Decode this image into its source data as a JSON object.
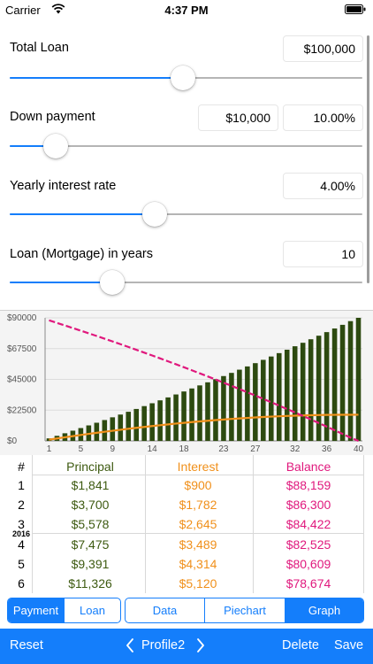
{
  "status": {
    "carrier": "Carrier",
    "time": "4:37 PM"
  },
  "fields": {
    "total_loan": {
      "label": "Total Loan",
      "value": "$100,000",
      "slider_fraction": 0.49
    },
    "down_payment": {
      "label": "Down payment",
      "value": "$10,000",
      "percent": "10.00%",
      "slider_fraction": 0.13
    },
    "interest_rate": {
      "label": "Yearly interest rate",
      "value": "4.00%",
      "slider_fraction": 0.41
    },
    "years": {
      "label": "Loan (Mortgage) in years",
      "value": "10",
      "slider_fraction": 0.29
    }
  },
  "chart_data": {
    "type": "bar",
    "x_ticks": [
      "1",
      "5",
      "9",
      "14",
      "18",
      "23",
      "27",
      "32",
      "36",
      "40"
    ],
    "y_ticks": [
      "$0",
      "$22500",
      "$45000",
      "$67500",
      "$90000"
    ],
    "ylim": [
      0,
      90000
    ],
    "x_count": 40,
    "series": [
      {
        "type": "bar",
        "color": "#2d4a10",
        "values": [
          1841,
          3700,
          5578,
          7475,
          9391,
          11326,
          13280,
          15255,
          17250,
          19265,
          21301,
          23358,
          25436,
          27535,
          29655,
          31797,
          33961,
          36147,
          38355,
          40586,
          42840,
          45117,
          47417,
          49741,
          52089,
          54460,
          56856,
          59277,
          61722,
          64193,
          66689,
          69210,
          71757,
          74330,
          76929,
          79555,
          82208,
          84887,
          87594,
          90000
        ]
      },
      {
        "type": "line",
        "color": "#f0901b",
        "values": [
          900,
          1782,
          2645,
          3489,
          4314,
          5120,
          5907,
          6674,
          7421,
          8148,
          8855,
          9541,
          10206,
          10850,
          11472,
          12072,
          12650,
          13206,
          13739,
          14249,
          14736,
          15199,
          15638,
          16053,
          16443,
          16808,
          17148,
          17462,
          17750,
          18012,
          18247,
          18455,
          18635,
          18788,
          18912,
          19008,
          19074,
          19111,
          19118,
          19150
        ]
      },
      {
        "type": "line",
        "style": "dashed",
        "color": "#e0187d",
        "values": [
          88159,
          86300,
          84422,
          82525,
          80609,
          78674,
          76720,
          74745,
          72750,
          70735,
          68699,
          66642,
          64564,
          62465,
          60345,
          58203,
          56039,
          53853,
          51645,
          49414,
          47160,
          44883,
          42583,
          40259,
          37911,
          35540,
          33144,
          30723,
          28278,
          25807,
          23311,
          20790,
          18243,
          15670,
          13071,
          10445,
          7792,
          5113,
          2406,
          0
        ]
      }
    ]
  },
  "table": {
    "headers": {
      "num": "#",
      "principal": "Principal",
      "interest": "Interest",
      "balance": "Balance"
    },
    "year_marker": "2016",
    "rows": [
      {
        "num": "1",
        "principal": "$1,841",
        "interest": "$900",
        "balance": "$88,159"
      },
      {
        "num": "2",
        "principal": "$3,700",
        "interest": "$1,782",
        "balance": "$86,300"
      },
      {
        "num": "3",
        "principal": "$5,578",
        "interest": "$2,645",
        "balance": "$84,422"
      },
      {
        "num": "4",
        "principal": "$7,475",
        "interest": "$3,489",
        "balance": "$82,525"
      },
      {
        "num": "5",
        "principal": "$9,391",
        "interest": "$4,314",
        "balance": "$80,609"
      },
      {
        "num": "6",
        "principal": "$11,326",
        "interest": "$5,120",
        "balance": "$78,674"
      }
    ]
  },
  "tabs": {
    "left": [
      "Payment",
      "Loan"
    ],
    "right": [
      "Data",
      "Piechart",
      "Graph"
    ],
    "active_left": "Payment",
    "active_right": "Graph"
  },
  "toolbar": {
    "reset": "Reset",
    "profile": "Profile2",
    "delete": "Delete",
    "save": "Save"
  },
  "colors": {
    "accent": "#147efb",
    "principal": "#3d5a10",
    "interest": "#f0901b",
    "balance": "#e0187d"
  }
}
